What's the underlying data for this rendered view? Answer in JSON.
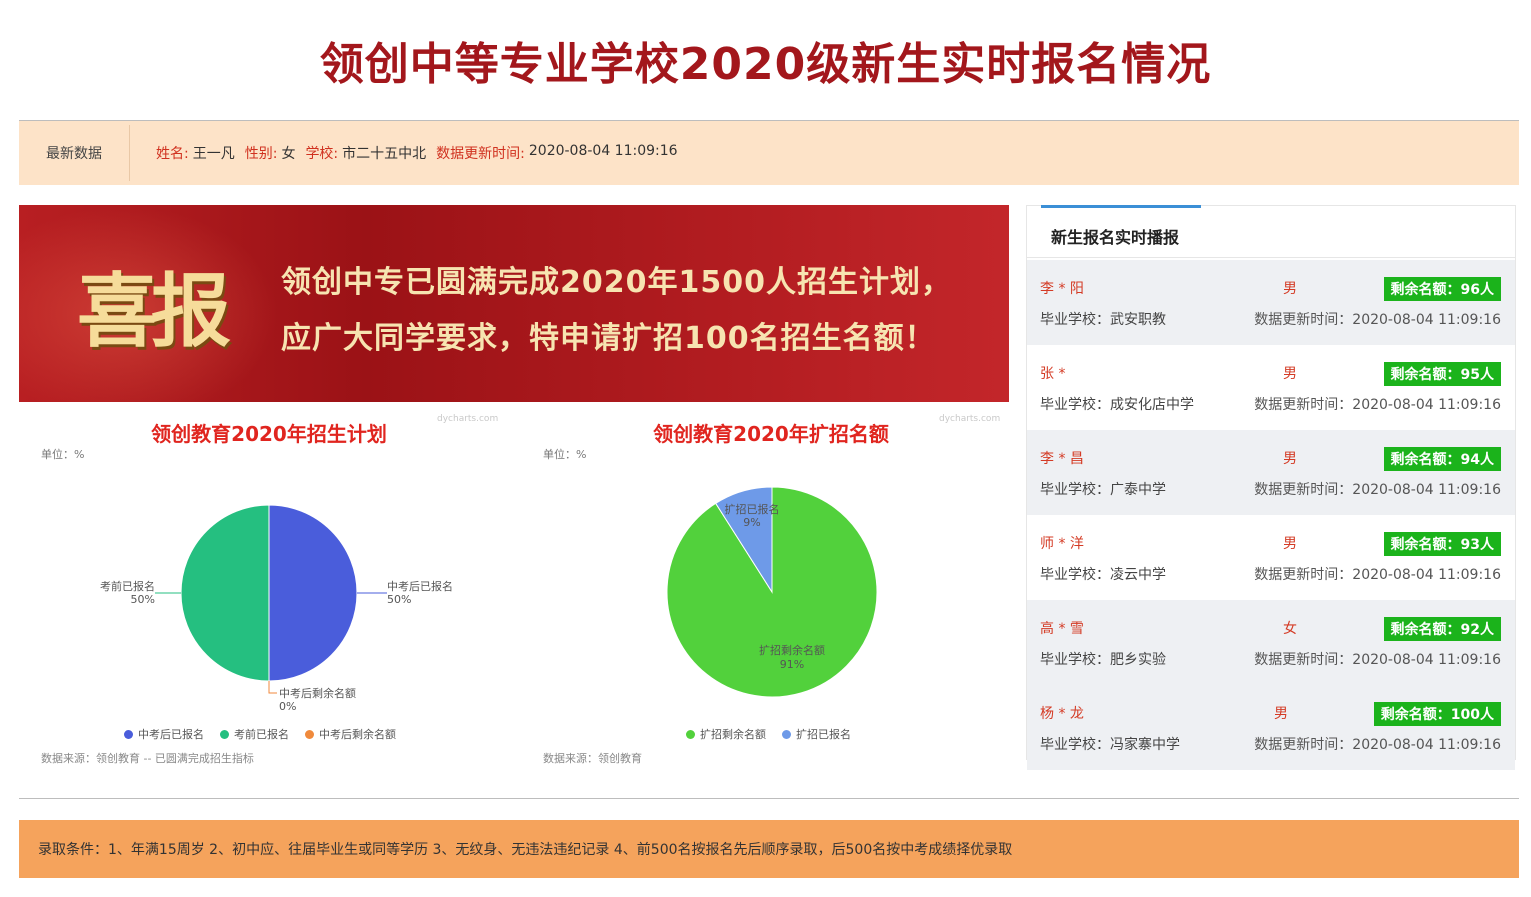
{
  "page": {
    "title": "领创中等专业学校2020级新生实时报名情况"
  },
  "latest": {
    "label": "最新数据",
    "name_key": "姓名:",
    "name_val": "王一凡",
    "gender_key": "性别:",
    "gender_val": "女",
    "school_key": "学校:",
    "school_val": "市二十五中北",
    "time_key": "数据更新时间:",
    "time_val": "2020-08-04 11:09:16"
  },
  "banner": {
    "big_word": "喜报",
    "line1": "领创中专已圆满完成2020年1500人招生计划，",
    "line2": "应广大同学要求，特申请扩招100名招生名额！"
  },
  "charts": {
    "watermark": "dycharts.com",
    "unit_label": "单位：%"
  },
  "chart_data": [
    {
      "type": "pie",
      "title": "领创教育2020年招生计划",
      "unit": "单位：%",
      "source": "数据来源：领创教育 -- 已圆满完成招生指标",
      "slices": [
        {
          "label": "中考后已报名",
          "value": 50,
          "value_text": "50%",
          "color": "#4a5ddb"
        },
        {
          "label": "考前已报名",
          "value": 50,
          "value_text": "50%",
          "color": "#25bf80"
        },
        {
          "label": "中考后剩余名额",
          "value": 0,
          "value_text": "0%",
          "color": "#f08a3c"
        }
      ]
    },
    {
      "type": "pie",
      "title": "领创教育2020年扩招名额",
      "unit": "单位：%",
      "source": "数据来源：领创教育",
      "slices": [
        {
          "label": "扩招剩余名额",
          "value": 91,
          "value_text": "91%",
          "color": "#52d13c"
        },
        {
          "label": "扩招已报名",
          "value": 9,
          "value_text": "9%",
          "color": "#6e9ae8"
        }
      ]
    }
  ],
  "feed": {
    "title": "新生报名实时播报",
    "school_prefix": "毕业学校：",
    "time_prefix": "数据更新时间：",
    "items": [
      {
        "name": "李 * 阳",
        "gender": "男",
        "badge": "剩余名额：96人",
        "school": "毕业学校：武安职教",
        "time": "数据更新时间：2020-08-04 11:09:16"
      },
      {
        "name": "张 *",
        "gender": "男",
        "badge": "剩余名额：95人",
        "school": "毕业学校：成安化店中学",
        "time": "数据更新时间：2020-08-04 11:09:16"
      },
      {
        "name": "李 * 昌",
        "gender": "男",
        "badge": "剩余名额：94人",
        "school": "毕业学校：广泰中学",
        "time": "数据更新时间：2020-08-04 11:09:16"
      },
      {
        "name": "师 * 洋",
        "gender": "男",
        "badge": "剩余名额：93人",
        "school": "毕业学校：凌云中学",
        "time": "数据更新时间：2020-08-04 11:09:16"
      },
      {
        "name": "高 * 雪",
        "gender": "女",
        "badge": "剩余名额：92人",
        "school": "毕业学校：肥乡实验",
        "time": "数据更新时间：2020-08-04 11:09:16"
      },
      {
        "name": "杨 * 龙",
        "gender": "男",
        "badge": "剩余名额：100人",
        "school": "毕业学校：冯家寨中学",
        "time": "数据更新时间：2020-08-04 11:09:16"
      }
    ]
  },
  "footer": {
    "text": "录取条件：1、年满15周岁 2、初中应、往届毕业生或同等学历 3、无纹身、无违法违纪记录 4、前500名按报名先后顺序录取，后500名按中考成绩择优录取"
  }
}
